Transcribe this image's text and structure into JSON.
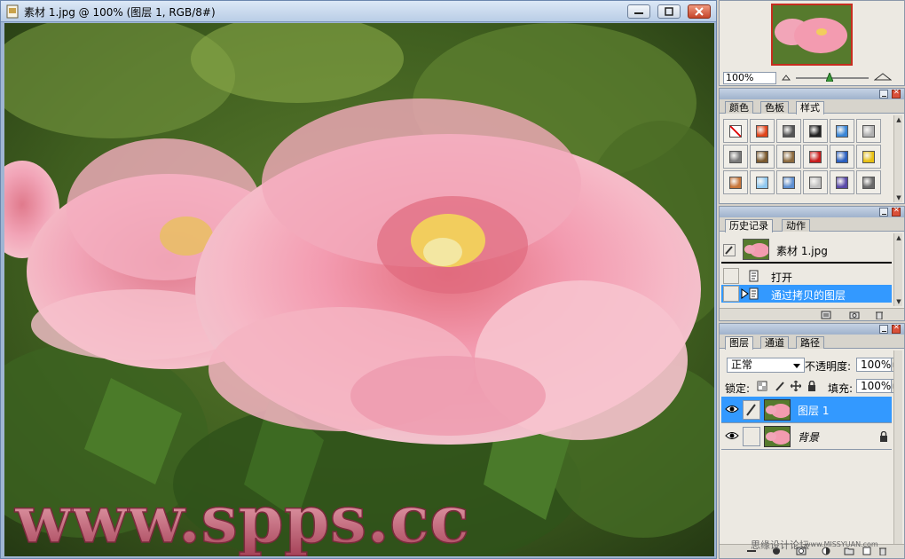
{
  "document": {
    "title": "素材 1.jpg @ 100% (图层 1, RGB/8#)",
    "image_watermark": "www.spps.cc"
  },
  "navigator": {
    "zoom": "100%"
  },
  "styles_panel": {
    "tabs": [
      {
        "label": "颜色"
      },
      {
        "label": "色板"
      },
      {
        "label": "样式"
      }
    ],
    "active_tab": 2,
    "swatches": [
      {
        "color": "#ffffff",
        "icon": "none-style-icon"
      },
      {
        "color": "#e0441a",
        "icon": "glow-style-icon"
      },
      {
        "color": "#555555",
        "icon": "dark-gray-style-icon"
      },
      {
        "color": "#222222",
        "icon": "black-sphere-style-icon"
      },
      {
        "color": "#3a86d6",
        "icon": "blue-glass-style-icon"
      },
      {
        "color": "#b0b0b0",
        "icon": "gray-style-icon"
      },
      {
        "color": "#7a7a7a",
        "icon": "chrome-style-icon"
      },
      {
        "color": "#7b5a2f",
        "icon": "brown-style-icon"
      },
      {
        "color": "#8c6a3d",
        "icon": "wood-style-icon"
      },
      {
        "color": "#c91d1d",
        "icon": "red-style-icon"
      },
      {
        "color": "#2a5fc0",
        "icon": "rainbow-style-icon"
      },
      {
        "color": "#e8c010",
        "icon": "yellow-style-icon"
      },
      {
        "color": "#c8763a",
        "icon": "orange-gradient-style-icon"
      },
      {
        "color": "#8fc8f0",
        "icon": "light-blue-style-icon"
      },
      {
        "color": "#5e8fd0",
        "icon": "sky-style-icon"
      },
      {
        "color": "#c0c0c0",
        "icon": "sparkle-style-icon"
      },
      {
        "color": "#5a4aa8",
        "icon": "purple-style-icon"
      },
      {
        "color": "#6a6a6a",
        "icon": "graphite-style-icon"
      }
    ]
  },
  "history_panel": {
    "tabs": [
      {
        "label": "历史记录"
      },
      {
        "label": "动作"
      }
    ],
    "snapshot_label": "素材 1.jpg",
    "steps": [
      {
        "label": "打开"
      },
      {
        "label": "通过拷贝的图层"
      }
    ]
  },
  "layers_panel": {
    "tabs": [
      {
        "label": "图层"
      },
      {
        "label": "通道"
      },
      {
        "label": "路径"
      }
    ],
    "blend_mode": "正常",
    "opacity_label": "不透明度:",
    "opacity_value": "100%",
    "lock_label": "锁定:",
    "fill_label": "填充:",
    "fill_value": "100%",
    "layers": [
      {
        "name": "图层 1"
      },
      {
        "name": "背景"
      }
    ]
  },
  "site_watermark": {
    "name": "思缘设计论坛",
    "url": "www.MISSYUAN.com"
  },
  "colors": {
    "selection": "#3399ff",
    "panel_bg": "#ece9e2"
  }
}
